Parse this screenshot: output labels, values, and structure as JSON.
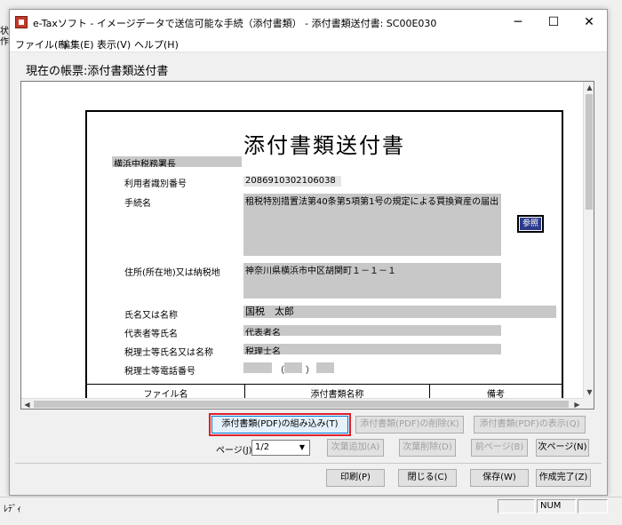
{
  "background": {
    "fragments": [
      "状態",
      "作成"
    ]
  },
  "window": {
    "title": "e-Taxソフト - イメージデータで送信可能な手続（添付書類） - 添付書類送付書: SC00E030",
    "controls": {
      "minimize": "─",
      "maximize": "☐",
      "close": "✕"
    }
  },
  "menu": [
    {
      "label": "ファイル(F)"
    },
    {
      "label": "編集(E)"
    },
    {
      "label": "表示(V)"
    },
    {
      "label": "ヘルプ(H)"
    }
  ],
  "form_title": "現在の帳票:添付書類送付書",
  "document": {
    "title": "添付書類送付書",
    "tax_office": "横浜中税務署長",
    "fields": [
      {
        "label": "利用者識別番号",
        "value": "2086910302106038"
      },
      {
        "label": "手続名",
        "value": "租税特別措置法第40条第5項第1号の規定による買換資産の届出"
      },
      {
        "label": "住所(所在地)又は納税地",
        "value": "神奈川県横浜市中区胡関町１－１－１"
      },
      {
        "label": "氏名又は名称",
        "value": "国税　太郎"
      },
      {
        "label": "代表者等氏名",
        "value": "代表者名"
      },
      {
        "label": "税理士等氏名又は名称",
        "value": "税理士名"
      },
      {
        "label": "税理士等電話番号",
        "value": ""
      }
    ],
    "phone_parts": [
      "（",
      "）"
    ],
    "reference_button": "参照",
    "table_headers": [
      "ファイル名",
      "添付書類名称",
      "備考"
    ]
  },
  "buttons": {
    "add_pdf": "添付書類(PDF)の組み込み(T)",
    "delete_pdf": "添付書類(PDF)の削除(K)",
    "show_pdf": "添付書類(PDF)の表示(Q)",
    "page_label": "ページ(J):",
    "page_value": "1/2",
    "add_next": "次葉追加(A)",
    "delete_next": "次葉削除(D)",
    "prev_page": "前ページ(B)",
    "next_page": "次ページ(N)",
    "print": "印刷(P)",
    "close": "閉じる(C)",
    "save": "保存(W)",
    "done": "作成完了(Z)"
  },
  "status": {
    "text": "ﾚﾃﾞｨ",
    "num": "NUM"
  }
}
